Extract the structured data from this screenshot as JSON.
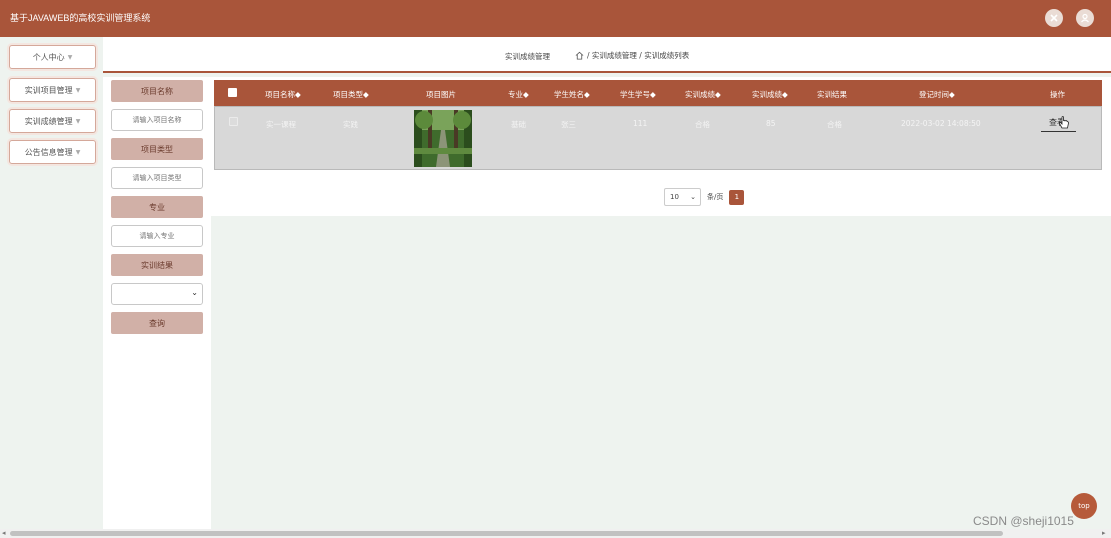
{
  "app": {
    "title": "基于JAVAWEB的高校实训管理系统",
    "accent_color": "#a9553a",
    "close_icon": "close-icon",
    "user_icon": "user-icon"
  },
  "sidebar": {
    "items": [
      {
        "label": "个人中心"
      },
      {
        "label": "实训项目管理"
      },
      {
        "label": "实训成绩管理"
      },
      {
        "label": "公告信息管理"
      }
    ]
  },
  "breadcrumb": {
    "module": "实训成绩管理",
    "path": "/ 实训成绩管理 / 实训成绩列表",
    "home_icon": "home-icon"
  },
  "search": {
    "project_name_label": "项目名称",
    "project_name_placeholder": "请输入项目名称",
    "project_type_label": "项目类型",
    "project_type_placeholder": "请输入项目类型",
    "major_label": "专业",
    "major_placeholder": "请输入专业",
    "result_label": "实训结果",
    "result_value": "",
    "query_button": "查询"
  },
  "table": {
    "columns": [
      "项目名称◆",
      "项目类型◆",
      "项目图片",
      "专业◆",
      "学生姓名◆",
      "学生学号◆",
      "实训成绩◆",
      "实训成绩◆",
      "实训结果",
      "登记时间◆",
      "操作"
    ],
    "rows": [
      {
        "project_name": "实一课程",
        "project_type": "实践",
        "image": "tree-lined path photo",
        "major": "基础",
        "student_name": "张三",
        "student_no": "111",
        "score": "合格",
        "score2": "85",
        "result": "合格",
        "time": "2022-03-02 14:08:50",
        "action": "查看"
      }
    ]
  },
  "pager": {
    "page_size": "10",
    "page_size_suffix": "条/页",
    "current_page": "1"
  },
  "top_button": "top",
  "watermark": "CSDN @sheji1015"
}
